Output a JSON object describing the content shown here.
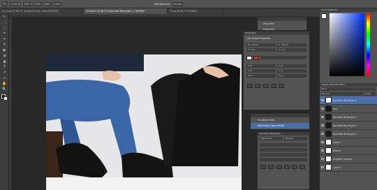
{
  "options_bar": {
    "fields": [
      "1250.30",
      "928.70",
      "550",
      "800",
      "1024"
    ],
    "interpolation_label": "Interpolation:",
    "interpolation_value": "Bicubic"
  },
  "tabs": [
    {
      "label": "Ai_pl.psd @ 66.7% (Gradient Color shoes @RGB/8)"
    },
    {
      "label": "Untitled-1 @ 66.7% (Rounded Rectangle 4, CMYK/8)*"
    },
    {
      "label": "29.jpg @ 66.7% (RGB/8)"
    }
  ],
  "tools": [
    "↖",
    "⬚",
    "◌",
    "✂",
    "⌖",
    "✎",
    "◐",
    "◍",
    "▲",
    "T",
    "↗",
    "▭",
    "✋",
    "🔍"
  ],
  "history_panel": {
    "items": [
      "Drag Path",
      "Drag Path"
    ]
  },
  "properties": {
    "title": "Properties",
    "section": "Live Shape Properties",
    "fields": [
      "W: 130 px",
      "H: 180 px",
      "X: 0 px",
      "Y: 0 px",
      "4 px",
      "4 px",
      "4 px",
      "4 px",
      "0 px",
      "0 px"
    ]
  },
  "history2": {
    "items": [
      "Transform Path",
      "Add Shape Layer Stroke"
    ]
  },
  "character": {
    "title": "Character",
    "title2": "Paragraph",
    "font": "Myriad Pro",
    "style": "Regular"
  },
  "right_panel": {
    "color_title": "Color",
    "swatches_title": "Swatches",
    "layers_title": "Layers",
    "channels_title": "Channels",
    "paths_title": "Paths",
    "kind": "Kind",
    "blend": "Normal",
    "opacity": "100%",
    "layers": [
      {
        "name": "Rounded Rectangle 5",
        "dark": false,
        "selected": true
      },
      {
        "name": "shp",
        "dark": true,
        "selected": false
      },
      {
        "name": "Rounded Rectangle 3",
        "dark": true,
        "selected": false
      },
      {
        "name": "Rounded Rectangle 2",
        "dark": true,
        "selected": false
      },
      {
        "name": "Rounded Rectangle 1",
        "dark": true,
        "selected": false
      },
      {
        "name": "Layer 1",
        "dark": false,
        "selected": false
      },
      {
        "name": "Effects",
        "dark": false,
        "selected": false
      },
      {
        "name": "Gradient Overlay",
        "dark": false,
        "selected": false
      },
      {
        "name": "Layer 0",
        "dark": false,
        "selected": false
      }
    ]
  }
}
